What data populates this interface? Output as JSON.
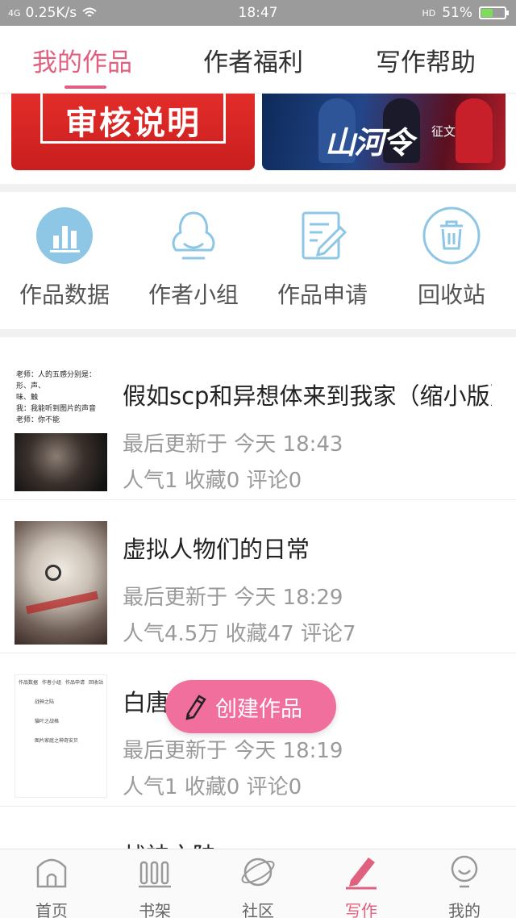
{
  "status_bar": {
    "signal": "4G",
    "speed": "0.25K/s",
    "time": "18:47",
    "hd": "HD",
    "battery_percent": "51%",
    "battery_level": 0.51
  },
  "top_tabs": [
    {
      "label": "我的作品",
      "active": true
    },
    {
      "label": "作者福利",
      "active": false
    },
    {
      "label": "写作帮助",
      "active": false
    }
  ],
  "banners": {
    "left_text": "审核说明",
    "right_calligraphy": "山河令",
    "right_tag": "征文"
  },
  "quick_actions": [
    {
      "label": "作品数据",
      "icon": "bar-chart-icon"
    },
    {
      "label": "作者小组",
      "icon": "group-icon"
    },
    {
      "label": "作品申请",
      "icon": "edit-document-icon"
    },
    {
      "label": "回收站",
      "icon": "trash-icon"
    }
  ],
  "works": [
    {
      "title": "假如scp和异想体来到我家（缩小版）",
      "updated": "最后更新于 今天 18:43",
      "stats": "人气1 收藏0 评论0",
      "thumb_lines": [
        "老师：人的五感分别是：形、声、",
        "味、触",
        "我：我能听到图片的声音",
        "老师：你不能"
      ]
    },
    {
      "title": "虚拟人物们的日常",
      "updated": "最后更新于 今天 18:29",
      "stats": "人气4.5万 收藏47 评论7",
      "thumb_lines": []
    },
    {
      "title": "白唐",
      "updated": "最后更新于 今天 18:19",
      "stats": "人气1 收藏0 评论0",
      "thumb_lines": [
        "作品数据",
        "作者小组",
        "作品申请",
        "回收站",
        "战神之陆",
        "貓叶之战格",
        "图片家庭之神奇安贝"
      ]
    },
    {
      "title": "战神之陆",
      "updated": "",
      "stats": "",
      "thumb_lines": []
    }
  ],
  "create_button": "创建作品",
  "bottom_nav": [
    {
      "label": "首页",
      "icon": "home-icon",
      "active": false
    },
    {
      "label": "书架",
      "icon": "bookshelf-icon",
      "active": false
    },
    {
      "label": "社区",
      "icon": "planet-icon",
      "active": false
    },
    {
      "label": "写作",
      "icon": "pen-icon",
      "active": true
    },
    {
      "label": "我的",
      "icon": "profile-icon",
      "active": false
    }
  ],
  "colors": {
    "accent": "#e0607f",
    "create_button": "#f06f9c",
    "icon_blue": "#8ec6e6"
  }
}
